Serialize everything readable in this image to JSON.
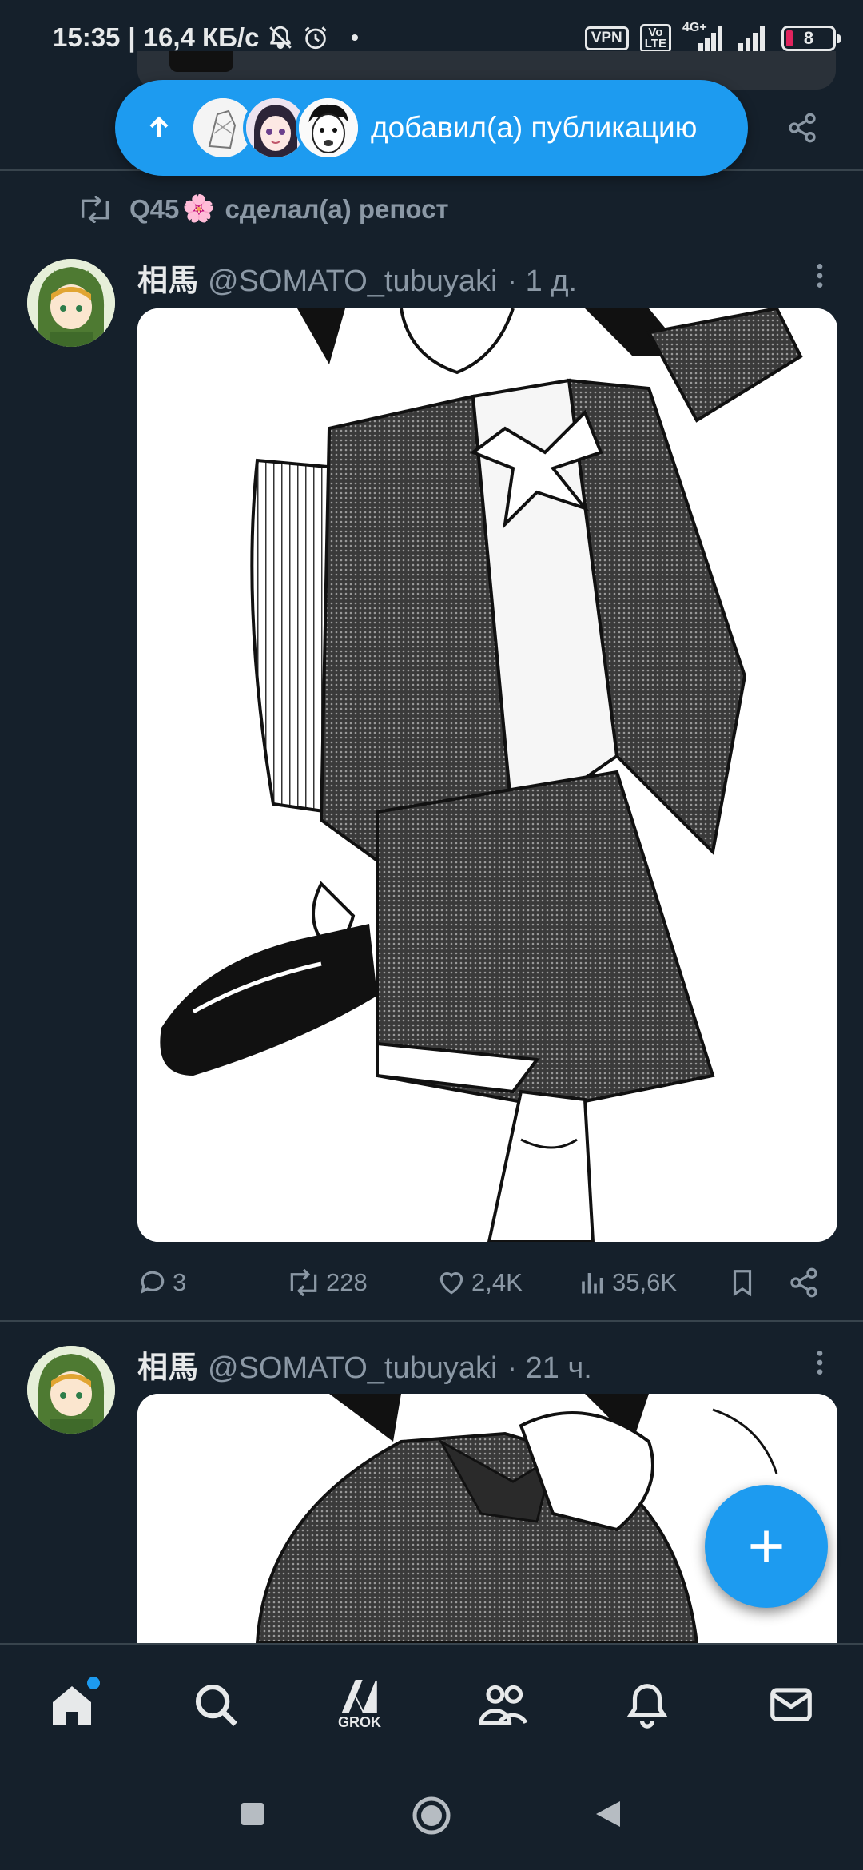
{
  "status_bar": {
    "time": "15:35",
    "network_speed": "16,4 КБ/с",
    "vpn_label": "VPN",
    "volte_label_top": "Vo",
    "volte_label_bottom": "LTE",
    "net_type": "4G+",
    "battery_level": "8",
    "icons": [
      "mute-bell-icon",
      "alarm-icon",
      "dot-icon",
      "signal-icon",
      "signal-icon",
      "battery-icon"
    ]
  },
  "new_posts_pill": {
    "label": "добавил(а) публикацию",
    "icon": "arrow-up-icon",
    "avatar_count": 3
  },
  "repost_banner": {
    "user": "Q45",
    "emoji": "🌸",
    "text": "сделал(а) репост"
  },
  "tweets": [
    {
      "name": "相馬",
      "handle": "@SOMATO_tubuyaki",
      "time": "· 1 д.",
      "actions": {
        "replies": "3",
        "reposts": "228",
        "likes": "2,4K",
        "views": "35,6K"
      }
    },
    {
      "name": "相馬",
      "handle": "@SOMATO_tubuyaki",
      "time": "· 21 ч."
    }
  ],
  "bottom_nav": {
    "items": [
      "home-icon",
      "search-icon",
      "grok-icon",
      "communities-icon",
      "notifications-icon",
      "messages-icon"
    ],
    "grok_label": "GROK"
  },
  "colors": {
    "background": "#15202b",
    "accent": "#1d9bf0",
    "text": "#e7e9ea",
    "muted": "#8b98a5",
    "divider": "#38444d"
  }
}
